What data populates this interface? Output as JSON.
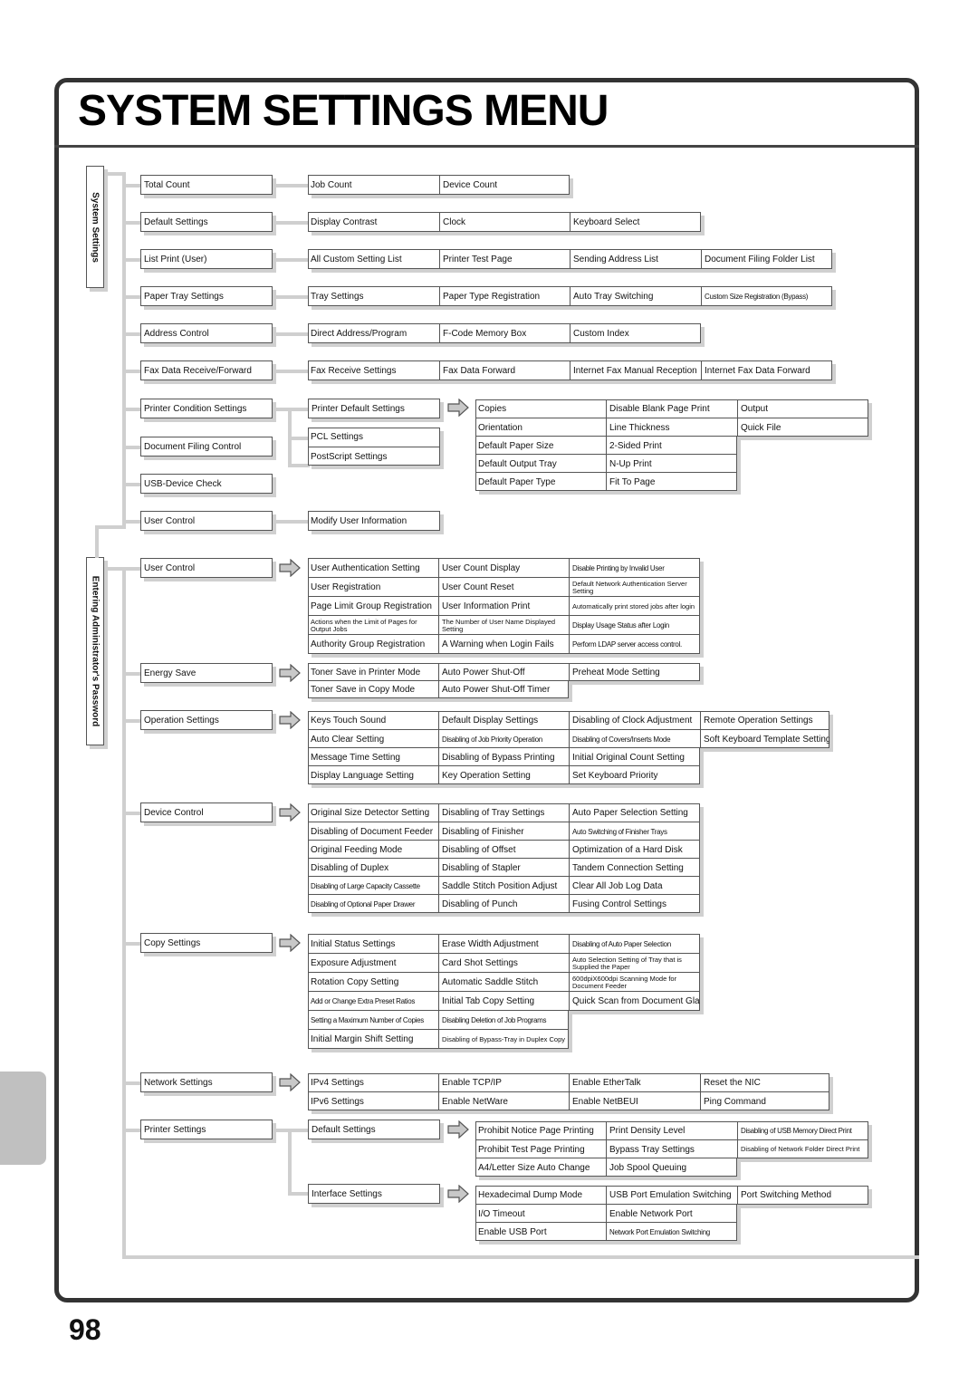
{
  "page": {
    "title": "SYSTEM SETTINGS MENU",
    "page_number": "98"
  },
  "groups": {
    "system_settings": "System Settings",
    "entering_admin": "Entering Administrator's Password"
  },
  "level1": [
    "Total Count",
    "Default Settings",
    "List Print (User)",
    "Paper Tray Settings",
    "Address Control",
    "Fax Data Receive/Forward",
    "Printer Condition Settings",
    "Document Filing Control",
    "USB-Device Check",
    "User Control",
    "User Control",
    "Energy Save",
    "Operation Settings",
    "Device Control",
    "Copy Settings",
    "Network Settings",
    "Printer Settings"
  ],
  "rows": {
    "total_count": [
      "Job Count",
      "Device Count"
    ],
    "default_settings": [
      "Display Contrast",
      "Clock",
      "Keyboard Select"
    ],
    "list_print": [
      "All Custom Setting List",
      "Printer Test Page",
      "Sending Address List",
      "Document Filing Folder List"
    ],
    "paper_tray": [
      "Tray Settings",
      "Paper Type Registration",
      "Auto Tray Switching",
      "Custom Size Registration (Bypass)"
    ],
    "address_control": [
      "Direct Address/Program",
      "F-Code Memory Box",
      "Custom Index"
    ],
    "fax_data": [
      "Fax Receive Settings",
      "Fax Data Forward",
      "Internet Fax Manual Reception",
      "Internet Fax Data Forward"
    ],
    "modify_user": [
      "Modify User Information"
    ]
  },
  "printer_condition": {
    "default_settings": "Printer Default Settings",
    "pcl": "PCL Settings",
    "postscript": "PostScript Settings",
    "grid": [
      [
        "Copies",
        "Disable Blank Page Print",
        "Output"
      ],
      [
        "Orientation",
        "Line Thickness",
        "Quick File"
      ],
      [
        "Default Paper Size",
        "2-Sided Print",
        ""
      ],
      [
        "Default Output Tray",
        "N-Up Print",
        ""
      ],
      [
        "Default Paper Type",
        "Fit To Page",
        ""
      ]
    ]
  },
  "admin_user_control": [
    [
      "User Authentication Setting",
      "User Count Display",
      "Disable Printing by Invalid User"
    ],
    [
      "User Registration",
      "User Count Reset",
      "Default Network Authentication Server Setting"
    ],
    [
      "Page Limit Group Registration",
      "User Information Print",
      "Automatically print stored jobs after login"
    ],
    [
      "Actions when the Limit of Pages for Output Jobs",
      "The Number of User Name Displayed Setting",
      "Display Usage Status after Login"
    ],
    [
      "Authority Group Registration",
      "A Warning when Login Fails",
      "Perform LDAP server access control."
    ]
  ],
  "energy_save": [
    [
      "Toner Save in Printer Mode",
      "Auto Power Shut-Off",
      "Preheat Mode Setting"
    ],
    [
      "Toner Save in Copy Mode",
      "Auto Power Shut-Off Timer",
      ""
    ]
  ],
  "operation_settings": [
    [
      "Keys Touch Sound",
      "Default Display Settings",
      "Disabling of Clock Adjustment",
      "Remote Operation Settings"
    ],
    [
      "Auto Clear Setting",
      "Disabling of Job Priority Operation",
      "Disabling of Covers/Inserts Mode",
      "Soft Keyboard Template Setting"
    ],
    [
      "Message Time Setting",
      "Disabling of Bypass Printing",
      "Initial Original Count Setting",
      ""
    ],
    [
      "Display Language Setting",
      "Key Operation Setting",
      "Set Keyboard Priority",
      ""
    ]
  ],
  "device_control": [
    [
      "Original Size Detector Setting",
      "Disabling of Tray Settings",
      "Auto Paper Selection Setting"
    ],
    [
      "Disabling of Document Feeder",
      "Disabling of Finisher",
      "Auto Switching of Finisher Trays"
    ],
    [
      "Original Feeding Mode",
      "Disabling of Offset",
      "Optimization of a Hard Disk"
    ],
    [
      "Disabling of Duplex",
      "Disabling of Stapler",
      "Tandem Connection Setting"
    ],
    [
      "Disabling of Large Capacity Cassette",
      "Saddle Stitch Position Adjust",
      "Clear All Job Log Data"
    ],
    [
      "Disabling of Optional Paper Drawer",
      "Disabling of Punch",
      "Fusing Control Settings"
    ]
  ],
  "copy_settings": [
    [
      "Initial Status Settings",
      "Erase Width Adjustment",
      "Disabling of Auto Paper Selection"
    ],
    [
      "Exposure Adjustment",
      "Card Shot Settings",
      "Auto Selection Setting of Tray that is Supplied the Paper"
    ],
    [
      "Rotation Copy Setting",
      "Automatic Saddle Stitch",
      "600dpiX600dpi Scanning Mode for Document Feeder"
    ],
    [
      "Add or Change Extra Preset Ratios",
      "Initial Tab Copy Setting",
      "Quick Scan from Document Glass"
    ],
    [
      "Setting a Maximum Number of Copies",
      "Disabling Deletion of Job Programs",
      ""
    ],
    [
      "Initial Margin Shift Setting",
      "Disabling of Bypass-Tray in Duplex Copy",
      ""
    ]
  ],
  "network_settings": [
    [
      "IPv4 Settings",
      "Enable TCP/IP",
      "Enable EtherTalk",
      "Reset the NIC"
    ],
    [
      "IPv6 Settings",
      "Enable NetWare",
      "Enable NetBEUI",
      "Ping Command"
    ]
  ],
  "printer_settings": {
    "default_settings": "Default Settings",
    "interface_settings": "Interface Settings",
    "default_grid": [
      [
        "Prohibit Notice Page Printing",
        "Print Density Level",
        "Disabling of USB Memory Direct Print"
      ],
      [
        "Prohibit Test Page Printing",
        "Bypass Tray Settings",
        "Disabling of Network Folder Direct Print"
      ],
      [
        "A4/Letter Size Auto Change",
        "Job Spool Queuing",
        ""
      ]
    ],
    "interface_grid": [
      [
        "Hexadecimal Dump Mode",
        "USB Port Emulation Switching",
        "Port Switching Method"
      ],
      [
        "I/O Timeout",
        "Enable Network Port",
        ""
      ],
      [
        "Enable USB Port",
        "Network Port Emulation Switching",
        ""
      ]
    ]
  },
  "icons": {
    "arrow": "right-arrow-icon"
  },
  "colors": {
    "frame": "#333333",
    "connector": "#cfcfcf",
    "box_border": "#555555",
    "shadow": "#d0d0d0",
    "side_tab": "#c0c0c0"
  }
}
